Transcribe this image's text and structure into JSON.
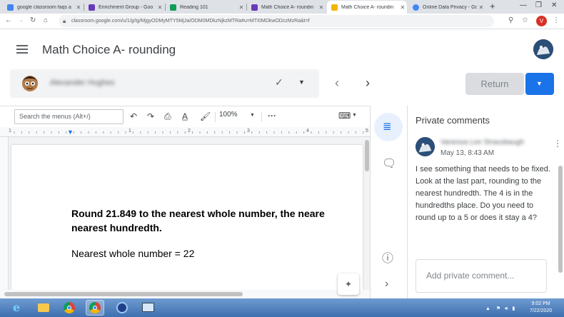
{
  "browser": {
    "tabs": [
      {
        "label": "google classroom faqs a",
        "color": "#4285f4"
      },
      {
        "label": "Enrichment Group - Goo",
        "color": "#673ab7"
      },
      {
        "label": "Reading 101",
        "color": "#0f9d58"
      },
      {
        "label": "Math Choice A- roundin",
        "color": "#673ab7"
      },
      {
        "label": "Math Choice A- roundin",
        "color": "#f4b400"
      },
      {
        "label": "Online Data Privacy - Go",
        "color": "#4285f4"
      }
    ],
    "new_tab": "+",
    "url": "classroom.google.com/u/1/g/tg/MjgyODMyMTY5MjJa/ODM0MDkzNjkzMTRa#u=MTI0MDkwODczMzRa&t=f",
    "profile_initial": "V"
  },
  "app": {
    "title": "Math Choice A- rounding",
    "student_name": "Alexander Hughes",
    "return_label": "Return"
  },
  "doc": {
    "menu_search_placeholder": "Search the menus (Alt+/)",
    "zoom": "100%",
    "more": "···",
    "ruler_numbers": [
      "1",
      "1",
      "2",
      "3",
      "4",
      "5"
    ],
    "question_line1": "Round 21.849 to the nearest whole number, the neare",
    "question_line2": "nearest hundredth.",
    "answer": "Nearest whole number = 22"
  },
  "comments": {
    "heading": "Private comments",
    "author": "Vanessa Lee Strausbaugh",
    "date": "May 13, 8:43 AM",
    "text": "I see something that needs to be fixed. Look at the last part, rounding to the nearest hundredth. The 4 is in the hundredths place. Do you need to round up to a 5 or does it stay a 4?",
    "input_placeholder": "Add private comment..."
  },
  "taskbar": {
    "time": "9:02 PM",
    "date": "7/22/2020"
  },
  "colors": {
    "accent": "#1a73e8",
    "taskbar": "#3d6fb0"
  }
}
